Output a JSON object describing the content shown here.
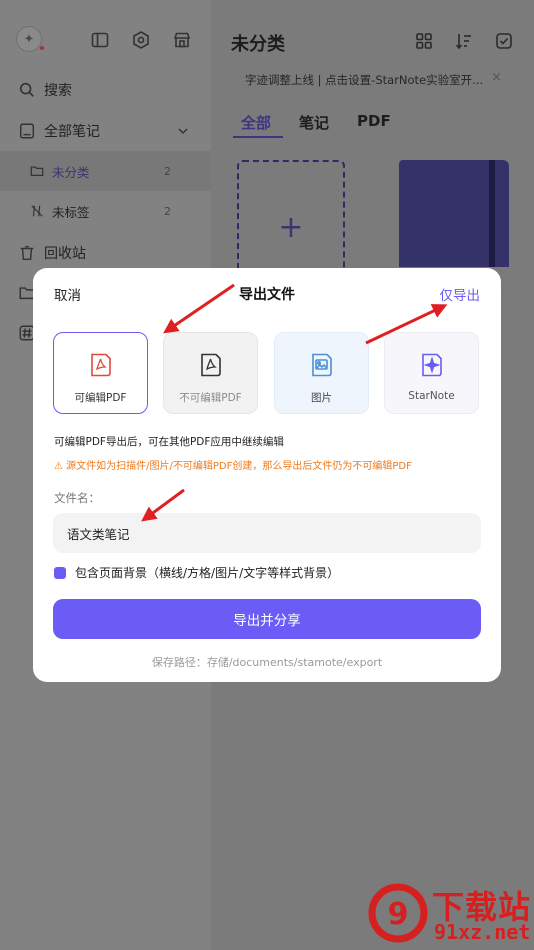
{
  "sidebar": {
    "search_label": "搜索",
    "all_notes_label": "全部笔记",
    "items": [
      {
        "label": "未分类",
        "count": "2"
      },
      {
        "label": "未标签",
        "count": "2"
      }
    ],
    "trash_label": "回收站"
  },
  "main": {
    "title": "未分类",
    "notice": "字迹调整上线 | 点击设置-StarNote实验室开...",
    "notice_close": "×",
    "tabs": [
      "全部",
      "笔记",
      "PDF"
    ],
    "new_card_glyph": "+"
  },
  "dialog": {
    "cancel_label": "取消",
    "title": "导出文件",
    "export_only_label": "仅导出",
    "options": [
      {
        "label": "可编辑PDF",
        "icon": "pdf-icon",
        "selected": true
      },
      {
        "label": "不可编辑PDF",
        "icon": "pdf-icon",
        "selected": false
      },
      {
        "label": "图片",
        "icon": "image-icon",
        "selected": false
      },
      {
        "label": "StarNote",
        "icon": "sparkle-icon",
        "selected": false
      }
    ],
    "description": "可编辑PDF导出后，可在其他PDF应用中继续编辑",
    "warning": "⚠ 源文件如为扫描件/图片/不可编辑PDF创建，那么导出后文件仍为不可编辑PDF",
    "filename_label": "文件名：",
    "filename_value": "语文类笔记",
    "include_background_label": "包含页面背景（横线/方格/图片/文字等样式背景）",
    "include_background_checked": true,
    "export_share_label": "导出并分享",
    "save_path": "保存路径：存储/documents/stamote/export"
  },
  "watermark": {
    "text_top": "下载站",
    "text_bottom": "91xz.net"
  },
  "colors": {
    "accent": "#6a5cf5",
    "warning": "#f07a1a",
    "pdf_red": "#e0483e",
    "image_blue": "#4a90d9",
    "annotation_red": "#e02020"
  }
}
